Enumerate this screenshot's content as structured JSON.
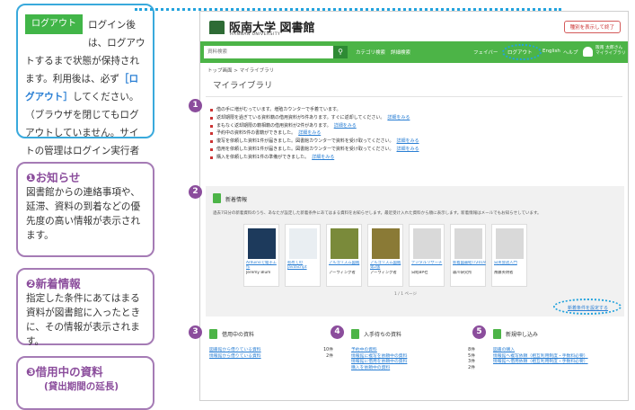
{
  "callout_login": {
    "badge": "ログアウト",
    "text_a": "ログイン後は、ログアウトするまで状態が保持されます。利用後は、必ず",
    "emphasis": "［ログアウト］",
    "text_b": "してください。（ブラウザを閉じてもログアウトしていません。サイトの管理はログイン実行者が責任をもって行ってください。）"
  },
  "callouts": [
    {
      "title": "❶お知らせ",
      "body": "図書館からの連絡事項や、延滞、資料の到着などの優先度の高い情報が表示されます。"
    },
    {
      "title": "❷新着情報",
      "body": "指定した条件にあてはまる資料が図書館に入ったときに、その情報が表示されます。"
    },
    {
      "title": "❸借用中の資料",
      "sub": "(貸出期間の延長)"
    }
  ],
  "colors": {
    "green": "#4cb447",
    "purple": "#8b4d9c",
    "cyan": "#23a3dd"
  },
  "library": {
    "logo": "阪南大学 図書館",
    "logo_sub": "HANNAN UNIVERSITY",
    "header_button": "種別を表示して終了",
    "search_placeholder": "資料検索",
    "nav": {
      "category": "カテゴリ検索",
      "detail": "詳細検索",
      "favorite": "フェイバー",
      "logout": "ログアウト",
      "english": "English",
      "help": "ヘルプ",
      "user": "阪南 太郎さん",
      "mylib": "マイライブラリ"
    },
    "breadcrumb": "トップ画面 > マイライブラリ",
    "page_title": "マイライブラリ",
    "notices": [
      {
        "text": "借の手に増がむっています。増殖カウンターで手着ています。",
        "link": ""
      },
      {
        "text": "返却期限を過ぎている資料籍の借用資料が5件あります。すぐに返却してください。",
        "link": "詳細をみる"
      },
      {
        "text": "まもなく返却期限の籍相籍の借用資料が2件があります。",
        "link": "詳細をみる"
      },
      {
        "text": "予約中の資料5件の書籍ができました。",
        "link": "詳細をみる"
      },
      {
        "text": "復写を依頼した資料1件が届きました。図書館カウンターで資料を受け取ってください。",
        "link": "詳細をみる"
      },
      {
        "text": "借用を依頼した資料1件が届きました。図書館カウンターで資料を受け取ってください。",
        "link": "詳細をみる"
      },
      {
        "text": "購入を依頼した資料1件の準備ができました。",
        "link": "詳細をみる"
      }
    ],
    "new_arrivals": {
      "title": "新着情報",
      "description": "過去7日分の新着資料のうち、あなたが設定した新着条件にあてはまる資料をお知らせします。最近受け入れた資料から順に表示します。新着情報はメールでもお知らせしています。",
      "books": [
        {
          "title": "Arduinoで電子工作",
          "author": "Jeremy Blum"
        },
        {
          "title": "初めてのJavaScript",
          "author": ""
        },
        {
          "title": "アルゴリズム図鑑",
          "author": "アーウィング者"
        },
        {
          "title": "アルゴリズム図鑑 第2版",
          "author": "アーウィング者"
        },
        {
          "title": "デジタルリサーチ",
          "author": "日経BP社"
        },
        {
          "title": "新着図書紹介2019",
          "author": "森川研究所"
        },
        {
          "title": "日英会話入門",
          "author": "斎藤英明者"
        }
      ],
      "pager": "1 / 1 ページ",
      "setting": "新着条件を設定する"
    },
    "sections": [
      {
        "title": "借用中の資料",
        "rows": [
          {
            "label": "図書館から借りている資料",
            "count": "10件"
          },
          {
            "label": "情報館から借りている資料",
            "count": "2件"
          }
        ]
      },
      {
        "title": "入手待ちの資料",
        "rows": [
          {
            "label": "予約中の資料",
            "count": "8件"
          },
          {
            "label": "情報館に複写を依頼中の資料",
            "count": "5件"
          },
          {
            "label": "情報館に借用を依頼中の資料",
            "count": "3件"
          },
          {
            "label": "購入を依頼中の資料",
            "count": "2件"
          }
        ]
      },
      {
        "title": "新規申し込み",
        "rows": [
          {
            "label": "図書の購入",
            "count": ""
          },
          {
            "label": "情報館へ複写依頼（相互利用制度・手数料必要）",
            "count": ""
          },
          {
            "label": "情報館へ借用依頼（相互利用制度・手数料必要）",
            "count": ""
          }
        ]
      }
    ]
  }
}
